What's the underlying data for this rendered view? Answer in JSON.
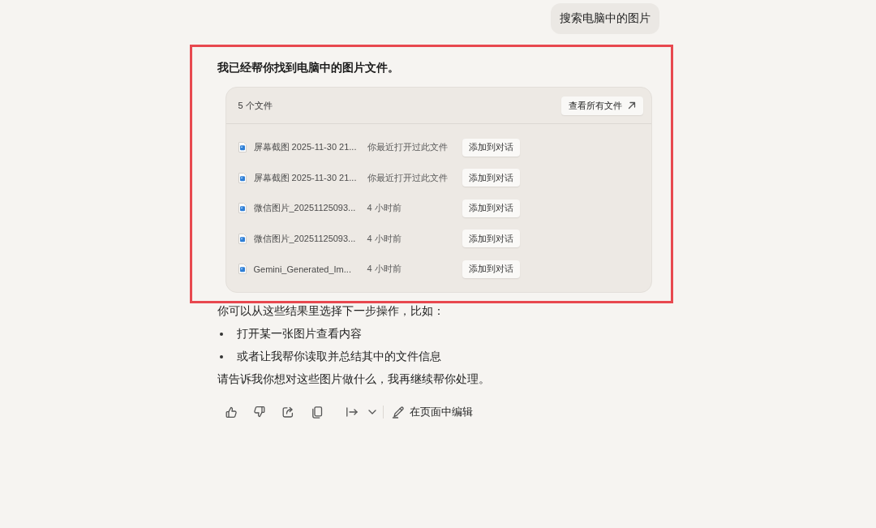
{
  "user_message": {
    "text": "搜索电脑中的图片"
  },
  "response": {
    "highlighted": true,
    "heading": "我已经帮你找到电脑中的图片文件。",
    "file_panel": {
      "count_label": "5 个文件",
      "view_all_button": "查看所有文件",
      "files": [
        {
          "name": "屏幕截图 2025-11-30 21...",
          "detail": "你最近打开过此文件",
          "add_button": "添加到对话"
        },
        {
          "name": "屏幕截图 2025-11-30 21...",
          "detail": "你最近打开过此文件",
          "add_button": "添加到对话"
        },
        {
          "name": "微信图片_20251125093...",
          "detail": "4 小时前",
          "add_button": "添加到对话"
        },
        {
          "name": "微信图片_20251125093...",
          "detail": "4 小时前",
          "add_button": "添加到对话"
        },
        {
          "name": "Gemini_Generated_Im...",
          "detail": "4 小时前",
          "add_button": "添加到对话"
        }
      ]
    }
  },
  "follow_up": {
    "intro": "你可以从这些结果里选择下一步操作，比如：",
    "bullets": [
      "打开某一张图片查看内容",
      "或者让我帮你读取并总结其中的文件信息"
    ],
    "closing": "请告诉我你想对这些图片做什么，我再继续帮你处理。"
  },
  "action_bar": {
    "edit_button": "在页面中编辑"
  }
}
